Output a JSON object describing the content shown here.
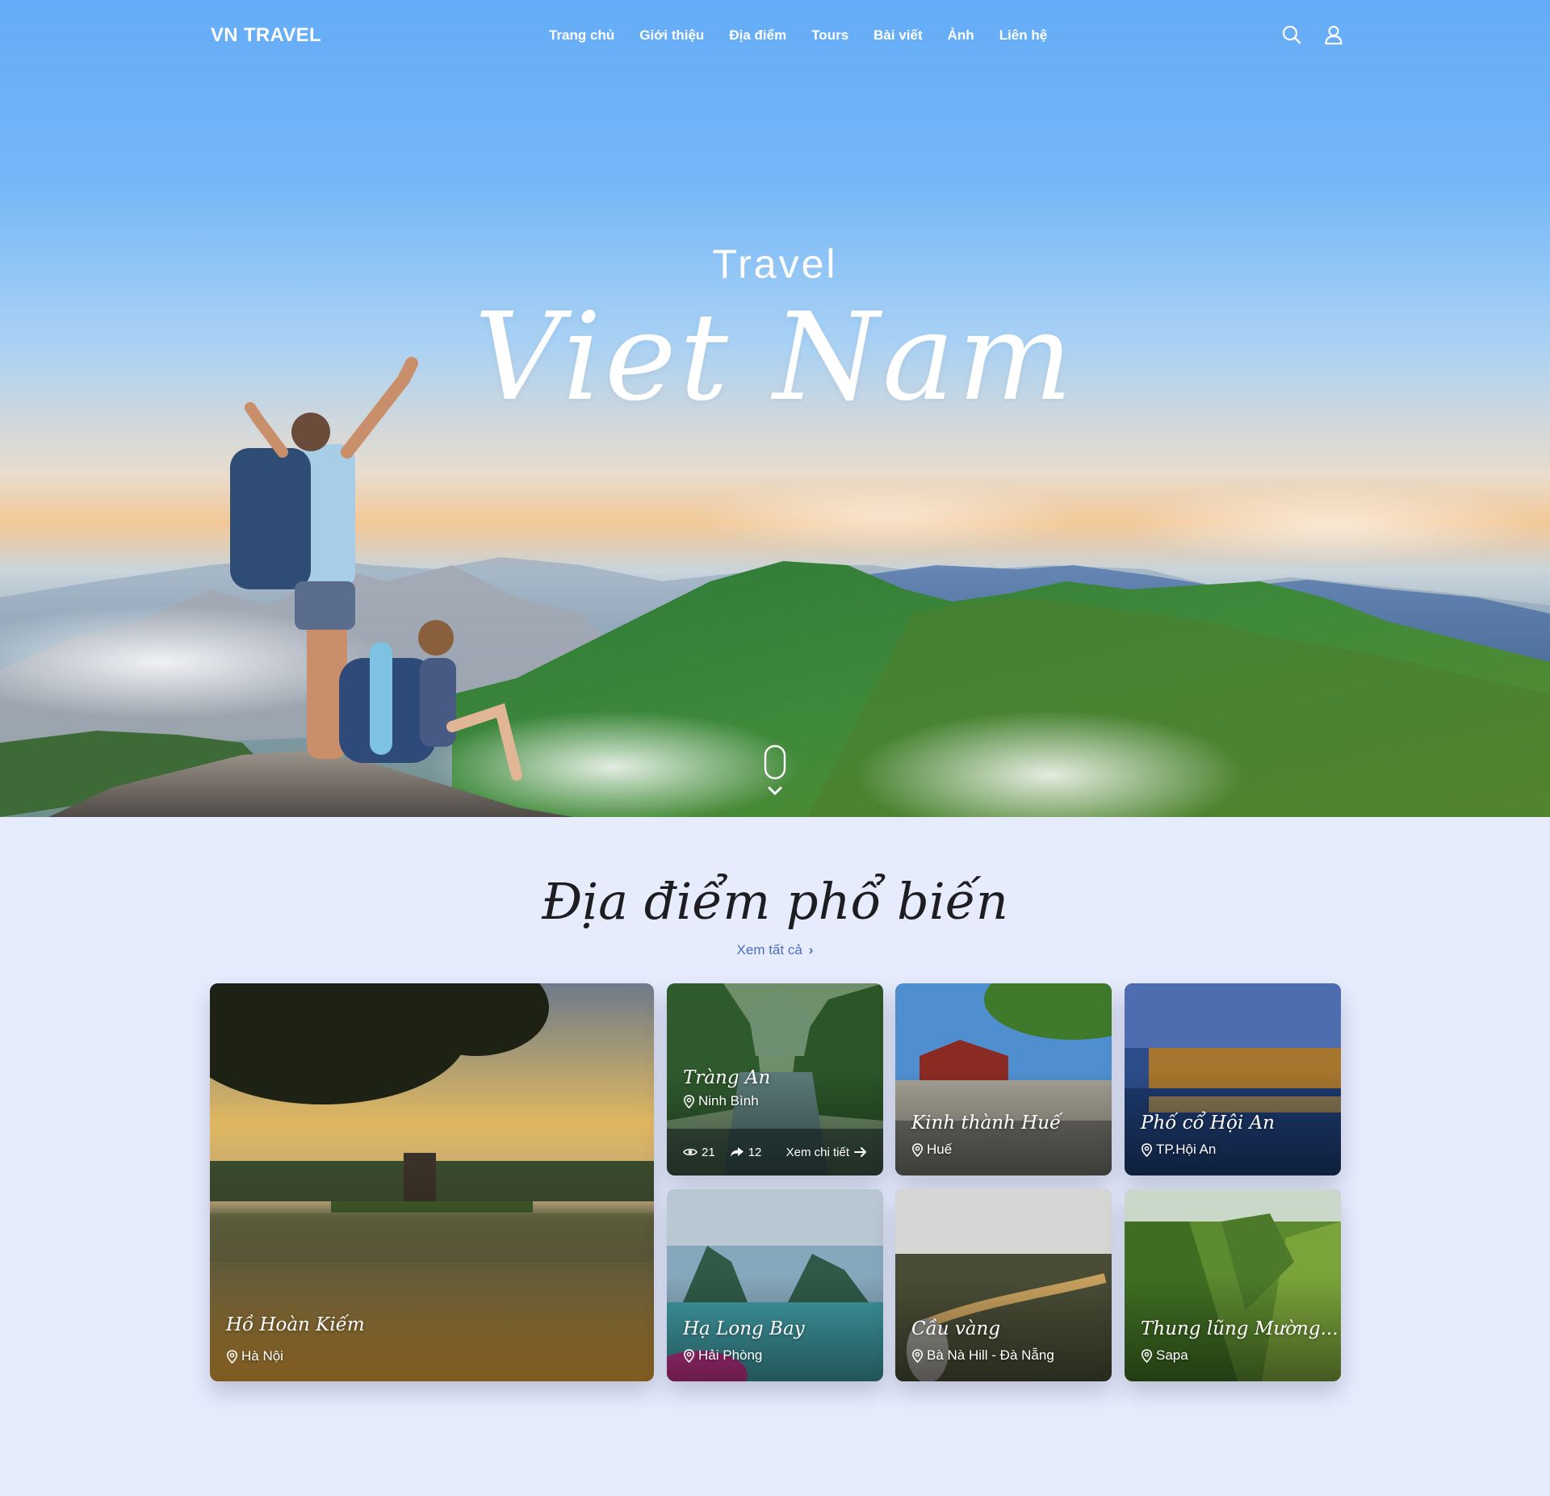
{
  "brand": "VN TRAVEL",
  "nav": {
    "items": [
      "Trang chủ",
      "Giới thiệu",
      "Địa điểm",
      "Tours",
      "Bài viết",
      "Ảnh",
      "Liên hệ"
    ],
    "icons": [
      "search-icon",
      "user-icon"
    ]
  },
  "hero": {
    "kicker": "Travel",
    "title": "Viet Nam"
  },
  "destinations": {
    "title": "Địa điểm phổ biến",
    "see_all": "Xem tất cả",
    "cards": [
      {
        "name": "Hồ Hoàn Kiếm",
        "location": "Hà Nội"
      },
      {
        "name": "Tràng An",
        "location": "Ninh Bình",
        "views": "21",
        "shares": "12",
        "detail": "Xem chi tiết"
      },
      {
        "name": "Kinh thành Huế",
        "location": "Huế"
      },
      {
        "name": "Phố cổ Hội An",
        "location": "TP.Hội An"
      },
      {
        "name": "Hạ Long Bay",
        "location": "Hải Phòng"
      },
      {
        "name": "Cầu vàng",
        "location": "Bà Nà Hill - Đà Nẵng"
      },
      {
        "name": "Thung lũng Mường...",
        "location": "Sapa"
      }
    ]
  },
  "colors": {
    "page_bg": "#e7ecfd",
    "sky": "#64acf7",
    "link": "#4a6fbf"
  }
}
